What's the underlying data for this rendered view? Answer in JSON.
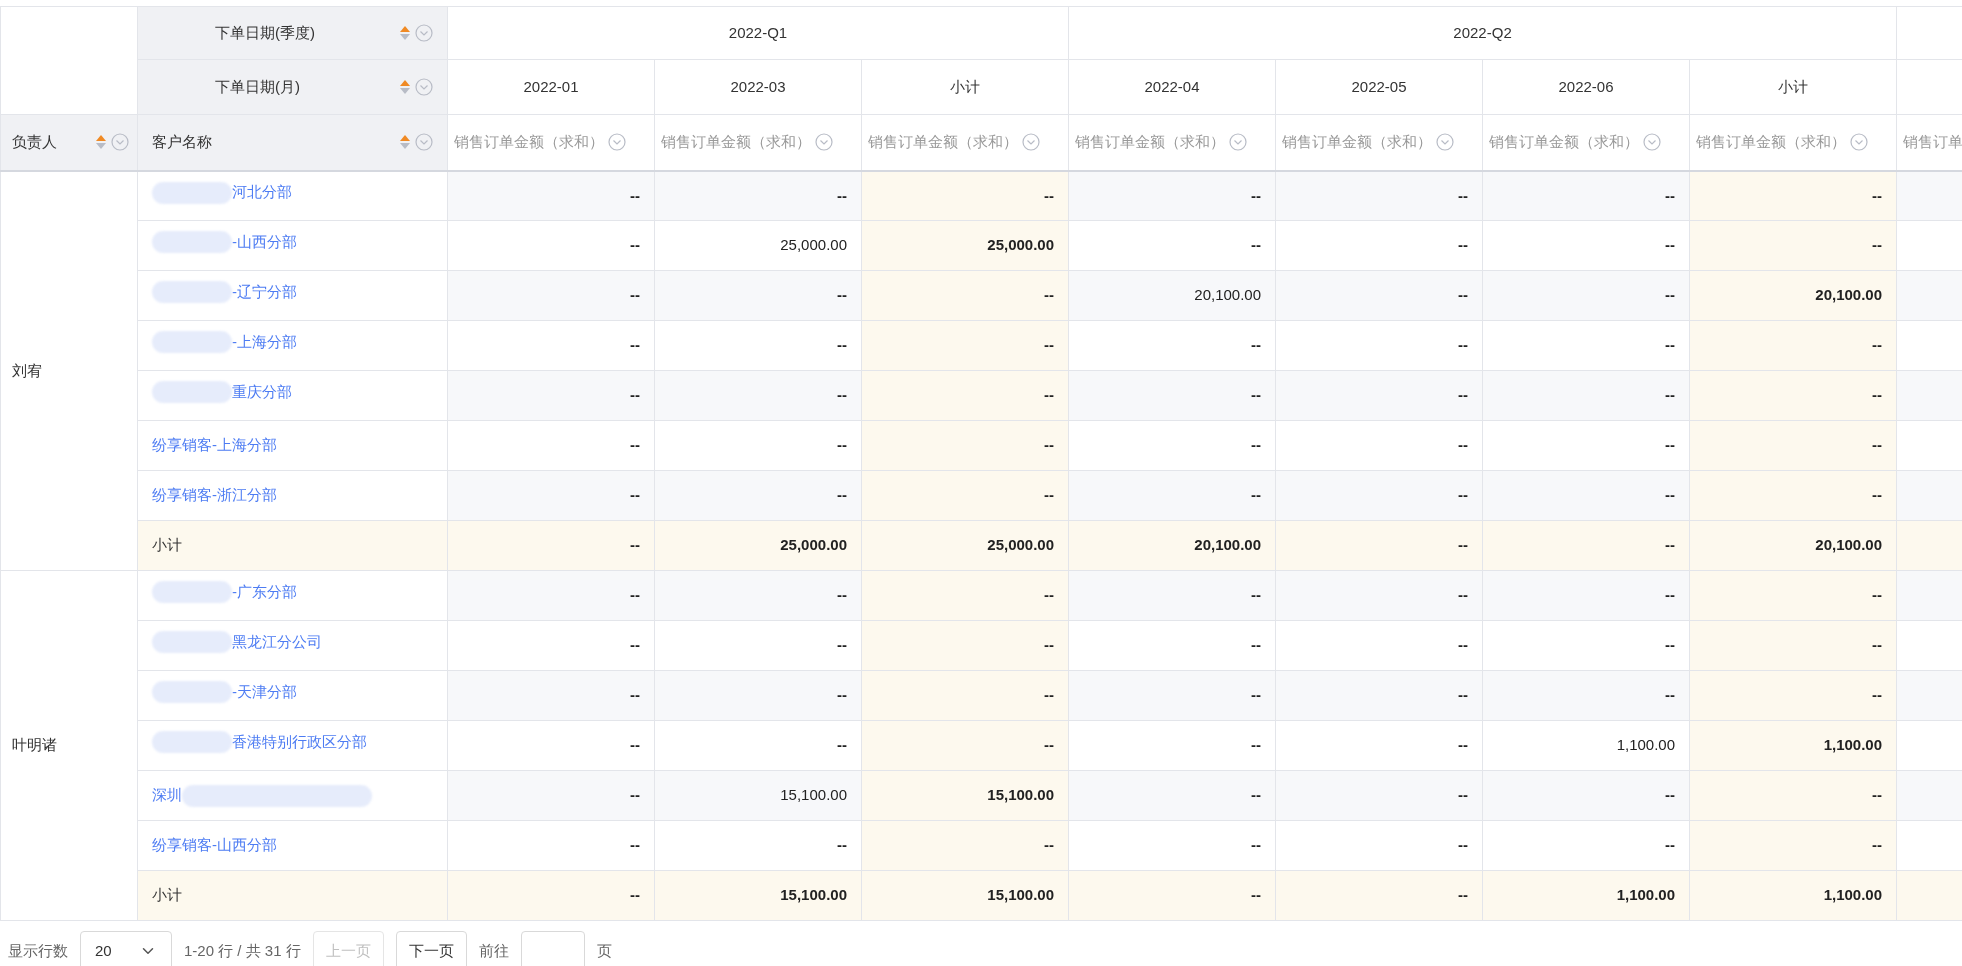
{
  "quarter_header": {
    "label": "下单日期(季度)"
  },
  "month_header": {
    "label": "下单日期(月)"
  },
  "owner_header": {
    "label": "负责人"
  },
  "customer_header": {
    "label": "客户名称"
  },
  "quarters": [
    {
      "label": "2022-Q1",
      "columns": [
        {
          "label": "2022-01",
          "kind": "month",
          "measure": "销售订单金额（求和）"
        },
        {
          "label": "2022-03",
          "kind": "month",
          "measure": "销售订单金额（求和）"
        },
        {
          "label": "小计",
          "kind": "subtotal",
          "measure": "销售订单金额（求和）"
        }
      ]
    },
    {
      "label": "2022-Q2",
      "columns": [
        {
          "label": "2022-04",
          "kind": "month",
          "measure": "销售订单金额（求和）"
        },
        {
          "label": "2022-05",
          "kind": "month",
          "measure": "销售订单金额（求和）"
        },
        {
          "label": "2022-06",
          "kind": "month",
          "measure": "销售订单金额（求和）"
        },
        {
          "label": "小计",
          "kind": "subtotal",
          "measure": "销售订单金额（求和）"
        }
      ]
    }
  ],
  "cut_column": {
    "measure": "销售订单"
  },
  "groups": [
    {
      "owner": "刘宥",
      "rows": [
        {
          "kind": "customer",
          "name": "河北分部",
          "blur_before": true,
          "blur_after": false,
          "values": [
            "--",
            "--",
            "--",
            "--",
            "--",
            "--",
            "--"
          ]
        },
        {
          "kind": "customer",
          "name": "-山西分部",
          "blur_before": true,
          "blur_after": false,
          "values": [
            "--",
            "25,000.00",
            "25,000.00",
            "--",
            "--",
            "--",
            "--"
          ]
        },
        {
          "kind": "customer",
          "name": "-辽宁分部",
          "blur_before": true,
          "blur_after": false,
          "values": [
            "--",
            "--",
            "--",
            "20,100.00",
            "--",
            "--",
            "20,100.00"
          ]
        },
        {
          "kind": "customer",
          "name": "-上海分部",
          "blur_before": true,
          "blur_after": false,
          "values": [
            "--",
            "--",
            "--",
            "--",
            "--",
            "--",
            "--"
          ]
        },
        {
          "kind": "customer",
          "name": "重庆分部",
          "blur_before": true,
          "blur_after": false,
          "values": [
            "--",
            "--",
            "--",
            "--",
            "--",
            "--",
            "--"
          ]
        },
        {
          "kind": "customer",
          "name": "纷享销客-上海分部",
          "blur_before": false,
          "blur_after": false,
          "values": [
            "--",
            "--",
            "--",
            "--",
            "--",
            "--",
            "--"
          ]
        },
        {
          "kind": "customer",
          "name": "纷享销客-浙江分部",
          "blur_before": false,
          "blur_after": false,
          "values": [
            "--",
            "--",
            "--",
            "--",
            "--",
            "--",
            "--"
          ]
        },
        {
          "kind": "subtotal",
          "name": "小计",
          "values": [
            "--",
            "25,000.00",
            "25,000.00",
            "20,100.00",
            "--",
            "--",
            "20,100.00"
          ]
        }
      ]
    },
    {
      "owner": "叶明诸",
      "rows": [
        {
          "kind": "customer",
          "name": "-广东分部",
          "blur_before": true,
          "blur_after": false,
          "values": [
            "--",
            "--",
            "--",
            "--",
            "--",
            "--",
            "--"
          ]
        },
        {
          "kind": "customer",
          "name": "黑龙江分公司",
          "blur_before": true,
          "blur_after": false,
          "values": [
            "--",
            "--",
            "--",
            "--",
            "--",
            "--",
            "--"
          ]
        },
        {
          "kind": "customer",
          "name": "-天津分部",
          "blur_before": true,
          "blur_after": false,
          "values": [
            "--",
            "--",
            "--",
            "--",
            "--",
            "--",
            "--"
          ]
        },
        {
          "kind": "customer",
          "name": "香港特别行政区分部",
          "blur_before": true,
          "blur_after": false,
          "values": [
            "--",
            "--",
            "--",
            "--",
            "--",
            "1,100.00",
            "1,100.00"
          ]
        },
        {
          "kind": "customer",
          "name": "深圳",
          "blur_before": false,
          "blur_after": true,
          "values": [
            "--",
            "15,100.00",
            "15,100.00",
            "--",
            "--",
            "--",
            "--"
          ]
        },
        {
          "kind": "customer",
          "name": "纷享销客-山西分部",
          "blur_before": false,
          "blur_after": false,
          "values": [
            "--",
            "--",
            "--",
            "--",
            "--",
            "--",
            "--"
          ]
        },
        {
          "kind": "subtotal",
          "name": "小计",
          "values": [
            "--",
            "15,100.00",
            "15,100.00",
            "--",
            "--",
            "1,100.00",
            "1,100.00"
          ]
        }
      ]
    }
  ],
  "pagination": {
    "rows_label": "显示行数",
    "page_size": "20",
    "range": "1-20 行 / 共 31 行",
    "prev": {
      "label": "上一页",
      "disabled": true
    },
    "next": {
      "label": "下一页",
      "disabled": false
    },
    "goto_label": "前往",
    "page_unit": "页"
  }
}
